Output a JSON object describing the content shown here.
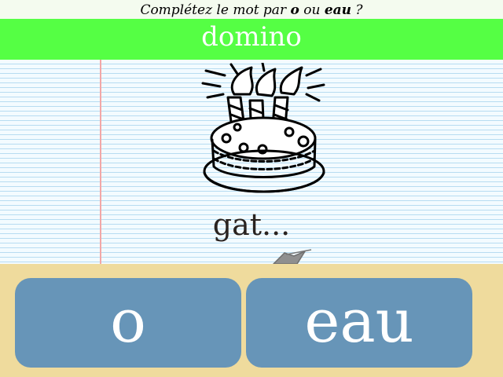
{
  "instruction": {
    "prefix": "Complétez le mot par ",
    "option_a": "o",
    "middle": " ou ",
    "option_b": "eau",
    "suffix": " ?"
  },
  "title": "domino",
  "prompt": {
    "image": "birthday-cake-with-candles",
    "word": "gat..."
  },
  "answers": [
    {
      "label": "o"
    },
    {
      "label": "eau"
    }
  ],
  "colors": {
    "title_bar": "#55ff44",
    "answer_button": "#6795b8",
    "answer_area": "#efdb9d",
    "notebook_line": "#b7dcf1",
    "margin_line": "#f2a7a7"
  }
}
